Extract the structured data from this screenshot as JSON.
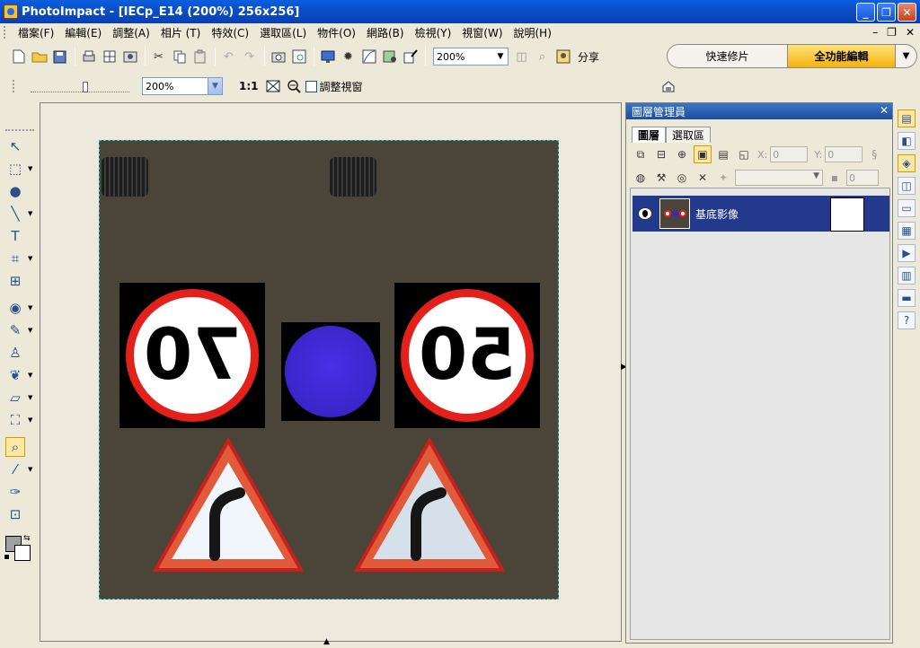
{
  "window": {
    "title": "PhotoImpact - [IECp_E14 (200%) 256x256]",
    "minimize": "_",
    "restore": "❐",
    "close": "✕"
  },
  "menu": {
    "items": [
      {
        "label": "檔案(F)"
      },
      {
        "label": "編輯(E)"
      },
      {
        "label": "調整(A)"
      },
      {
        "label": "相片 (T)"
      },
      {
        "label": "特效(C)"
      },
      {
        "label": "選取區(L)"
      },
      {
        "label": "物件(O)"
      },
      {
        "label": "網路(B)"
      },
      {
        "label": "檢視(Y)"
      },
      {
        "label": "視窗(W)"
      },
      {
        "label": "說明(H)"
      }
    ],
    "doc_minimize": "–",
    "doc_restore": "❐",
    "doc_close": "✕"
  },
  "toolbar": {
    "icons": [
      "new-icon",
      "open-icon",
      "save-icon",
      "scan-icon",
      "grid-icon",
      "camera-icon",
      "cut-icon",
      "copy-icon",
      "paste-icon",
      "undo-icon",
      "redo-icon",
      "snapshot-icon",
      "capture-icon",
      "monitor-icon",
      "brightness-icon",
      "curve-icon",
      "enhance-icon",
      "pen-frame-icon"
    ],
    "zoom_value": "200%",
    "share_label": "分享"
  },
  "mode": {
    "quick_label": "快速修片",
    "full_label": "全功能編輯",
    "dropdown": "▼"
  },
  "options_bar": {
    "zoom_value": "200%",
    "actual_size_label": "1:1",
    "fit_window_label": "調整視窗"
  },
  "image": {
    "speed_left": "70",
    "speed_right": "50"
  },
  "layers_panel": {
    "title": "圖層管理員",
    "close": "✕",
    "tabs": [
      {
        "label": "圖層"
      },
      {
        "label": "選取區"
      }
    ],
    "x_label": "X:",
    "x_value": "0",
    "y_label": "Y:",
    "y_value": "0",
    "opacity_value": "0",
    "layer_name": "基底影像"
  }
}
